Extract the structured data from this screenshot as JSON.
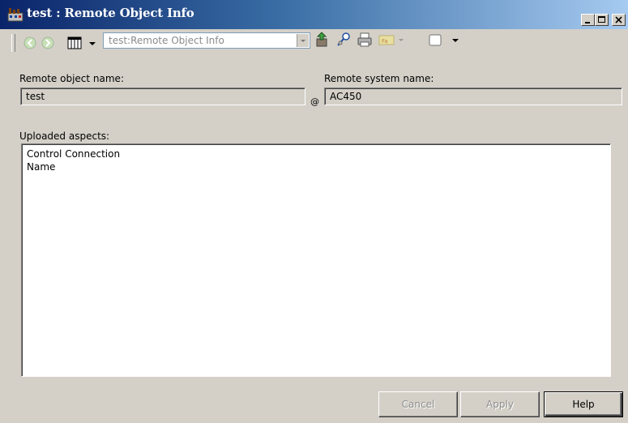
{
  "window": {
    "title": "test : Remote Object Info",
    "controls": [
      "minimize-icon",
      "maximize-icon",
      "close-icon"
    ]
  },
  "toolbar": {
    "address_value": "test:Remote Object Info",
    "icons": [
      "back-arrow-icon",
      "forward-arrow-icon",
      "columns-view-icon",
      "dropdown-arrow-icon",
      "combo-dropdown-icon",
      "upload-icon",
      "pin-icon",
      "print-icon",
      "aspect-icon",
      "dropdown-arrow-icon",
      "window-icon",
      "dropdown-arrow-icon"
    ]
  },
  "form": {
    "remote_object_label": "Remote object name:",
    "remote_object_value": "test",
    "at_symbol": "@",
    "remote_system_label": "Remote system name:",
    "remote_system_value": "AC450",
    "uploaded_label": "Uploaded aspects:",
    "uploaded_items": [
      "Control Connection",
      "Name"
    ]
  },
  "buttons": {
    "cancel": "Cancel",
    "apply": "Apply",
    "help": "Help"
  },
  "colors": {
    "dialog_bg": "#d4d0c8",
    "titlebar_start": "#0a246a",
    "titlebar_end": "#a6caf0"
  }
}
